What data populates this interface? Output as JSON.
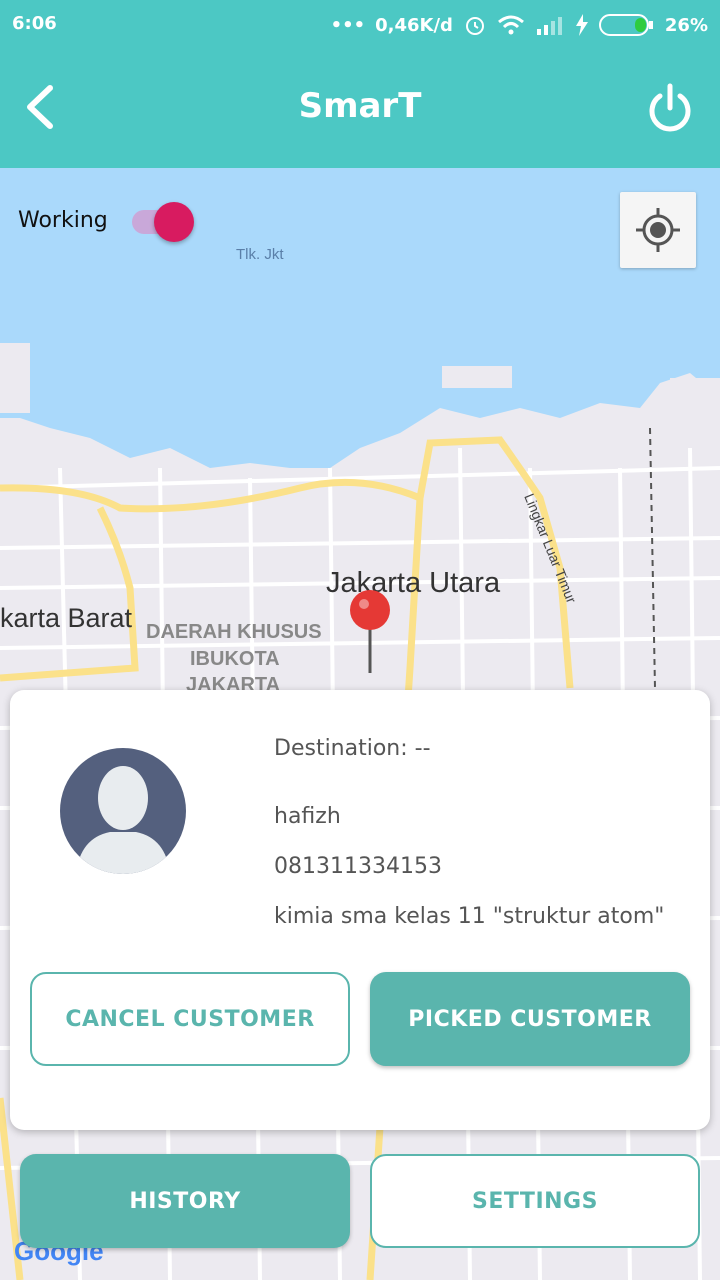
{
  "status_bar": {
    "time": "6:06",
    "network_speed": "0,46K/d",
    "battery": "26%"
  },
  "app_bar": {
    "title": "SmarT",
    "back_icon": "chevron-left-icon",
    "power_icon": "power-icon"
  },
  "map": {
    "labels": {
      "bay": "Tlk. Jkt",
      "district_north": "Jakarta Utara",
      "district_west": "karta Barat",
      "special_region_line1": "DAERAH KHUSUS",
      "special_region_line2": "IBUKOTA",
      "special_region_line3": "JAKARTA",
      "ring_road": "Lingkar Luar Timur",
      "google": "Google"
    },
    "colors": {
      "water": "#aad9fb",
      "land": "#eceaf0",
      "road_major": "#fbe18a",
      "road_minor": "#ffffff"
    }
  },
  "working_toggle": {
    "label": "Working",
    "on": true,
    "accent": "#d81b60"
  },
  "customer_card": {
    "destination": "Destination: --",
    "name": "hafizh",
    "phone": "081311334153",
    "note": "kimia sma kelas 11 \"struktur atom\"",
    "cancel_label": "CANCEL CUSTOMER",
    "picked_label": "PICKED CUSTOMER"
  },
  "bottom_buttons": {
    "history_label": "HISTORY",
    "settings_label": "SETTINGS"
  },
  "colors": {
    "primary": "#4cc8c4",
    "button": "#5ab5ad",
    "pin": "#e53935"
  }
}
